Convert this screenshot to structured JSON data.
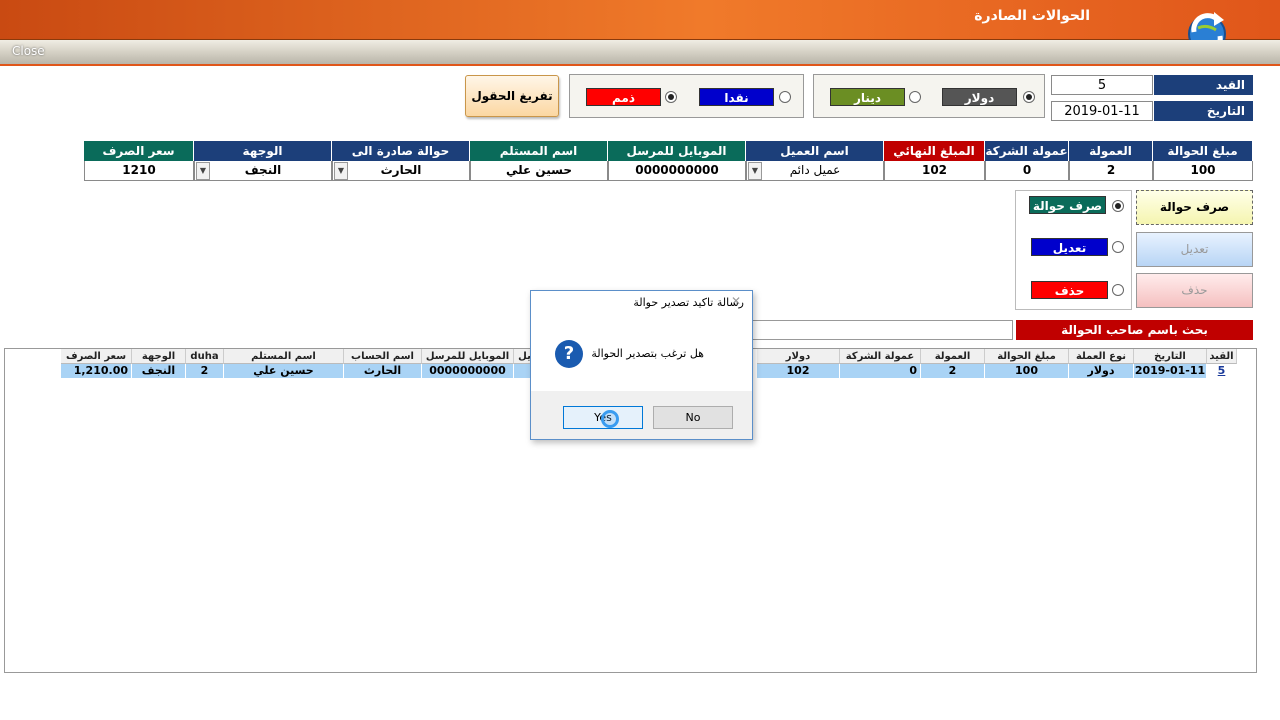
{
  "window": {
    "title": "الحوالات الصادرة",
    "close_label": "Close"
  },
  "header": {
    "qaid_label": "القيد",
    "qaid_value": "5",
    "date_label": "التاريخ",
    "date_value": "2019-01-11",
    "currency_options": [
      {
        "label": "دولار",
        "selected": true,
        "color": "#555555"
      },
      {
        "label": "دينار",
        "selected": false,
        "color": "#6b8e23"
      }
    ],
    "payment_options": [
      {
        "label": "نقدا",
        "selected": false,
        "color": "#0000cc"
      },
      {
        "label": "ذمم",
        "selected": true,
        "color": "#ff0000"
      }
    ],
    "clear_button": "تفريغ الحقول"
  },
  "form_grid": {
    "headers": [
      "مبلغ الحوالة",
      "العمولة",
      "عمولة الشركة",
      "المبلغ النهائي",
      "اسم العميل",
      "الموبايل للمرسل",
      "اسم المستلم",
      "حوالة صادرة الى",
      "الوجهة",
      "سعر الصرف"
    ],
    "values": [
      "100",
      "2",
      "0",
      "102",
      "عميل دائم",
      "0000000000",
      "حسين علي",
      "الحارث",
      "النجف",
      "1210"
    ]
  },
  "operations": {
    "pay_label": "صرف حوالة",
    "pay_button": "صرف حوالة",
    "edit_label": "تعديل",
    "edit_button": "تعديل",
    "delete_label": "حذف",
    "delete_button": "حذف"
  },
  "search": {
    "label": "بحث باسم صاحب الحوالة",
    "value": ""
  },
  "table": {
    "headers": [
      "القيد",
      "التاريخ",
      "نوع العملة",
      "مبلغ الحوالة",
      "العمولة",
      "عمولة الشركة",
      "دولار",
      "يل",
      "الموبايل للمرسل",
      "اسم الحساب",
      "اسم المستلم",
      "duha",
      "الوجهة",
      "سعر الصرف"
    ],
    "rows": [
      [
        "5",
        "2019-01-11",
        "دولار",
        "100",
        "2",
        "0",
        "102",
        "",
        "0000000000",
        "الحارث",
        "حسين علي",
        "2",
        "النجف",
        "1,210.00"
      ]
    ]
  },
  "dialog": {
    "title": "رسالة تاكيد تصدير حوالة",
    "message": "هل ترغب بتصدير الحوالة",
    "yes": "Yes",
    "no": "No"
  }
}
